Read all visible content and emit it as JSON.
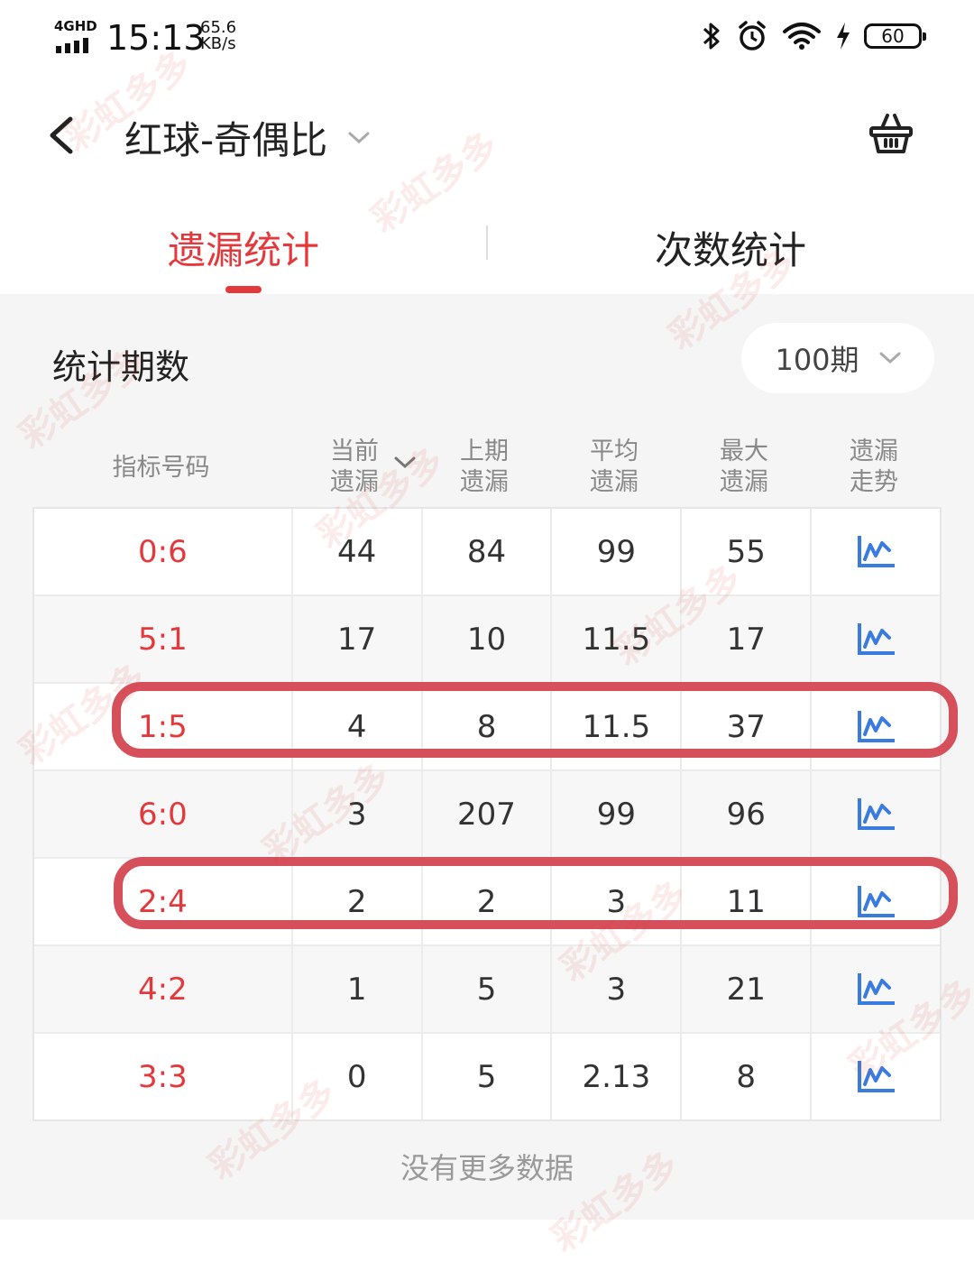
{
  "status_bar": {
    "network": "4GHD",
    "time": "15:13",
    "speed_value": "65.6",
    "speed_unit": "KB/s",
    "battery": "60",
    "icons": [
      "bluetooth-icon",
      "alarm-icon",
      "wifi-icon",
      "charging-icon",
      "battery-icon"
    ]
  },
  "nav": {
    "title": "红球-奇偶比",
    "back_icon": "chevron-left-icon",
    "dropdown_icon": "chevron-down-icon",
    "cart_icon": "basket-icon"
  },
  "tabs": [
    {
      "label": "遗漏统计",
      "active": true
    },
    {
      "label": "次数统计",
      "active": false
    }
  ],
  "period": {
    "label": "统计期数",
    "value": "100期"
  },
  "table": {
    "headers": [
      {
        "line1": "指标号码",
        "line2": ""
      },
      {
        "line1": "当前",
        "line2": "遗漏"
      },
      {
        "line1": "上期",
        "line2": "遗漏"
      },
      {
        "line1": "平均",
        "line2": "遗漏"
      },
      {
        "line1": "最大",
        "line2": "遗漏"
      },
      {
        "line1": "遗漏",
        "line2": "走势"
      }
    ],
    "rows": [
      {
        "code": "0:6",
        "current": "44",
        "last": "84",
        "avg": "99",
        "max": "55",
        "highlighted": false
      },
      {
        "code": "5:1",
        "current": "17",
        "last": "10",
        "avg": "11.5",
        "max": "17",
        "highlighted": false
      },
      {
        "code": "1:5",
        "current": "4",
        "last": "8",
        "avg": "11.5",
        "max": "37",
        "highlighted": true
      },
      {
        "code": "6:0",
        "current": "3",
        "last": "207",
        "avg": "99",
        "max": "96",
        "highlighted": false
      },
      {
        "code": "2:4",
        "current": "2",
        "last": "2",
        "avg": "3",
        "max": "11",
        "highlighted": true
      },
      {
        "code": "4:2",
        "current": "1",
        "last": "5",
        "avg": "3",
        "max": "21",
        "highlighted": false
      },
      {
        "code": "3:3",
        "current": "0",
        "last": "5",
        "avg": "2.13",
        "max": "8",
        "highlighted": false
      }
    ]
  },
  "footer": {
    "no_more": "没有更多数据"
  },
  "watermark": "彩虹多多",
  "colors": {
    "accent": "#e4393c",
    "highlight_border": "#d6505b",
    "trend_icon": "#3a7be0",
    "background": "#f5f5f5"
  }
}
